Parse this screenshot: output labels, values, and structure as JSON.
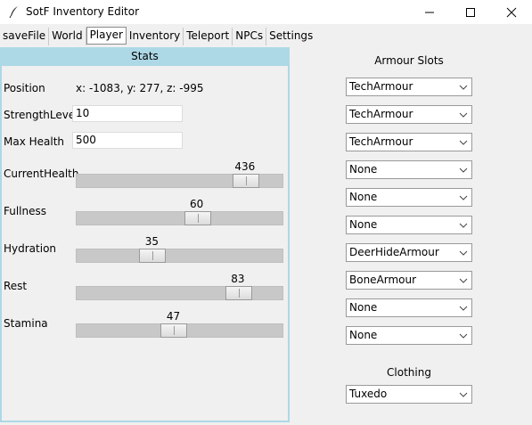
{
  "window": {
    "title": "SotF Inventory Editor"
  },
  "tabs": [
    {
      "label": "saveFile"
    },
    {
      "label": "World"
    },
    {
      "label": "Player",
      "active": true
    },
    {
      "label": "Inventory"
    },
    {
      "label": "Teleport"
    },
    {
      "label": "NPCs"
    },
    {
      "label": "Settings"
    }
  ],
  "stats": {
    "header": "Stats",
    "position": {
      "label": "Position",
      "value": "x: -1083, y: 277, z: -995"
    },
    "strength_level": {
      "label": "StrengthLevel",
      "value": "10"
    },
    "max_health": {
      "label": "Max Health",
      "value": "500"
    },
    "sliders": [
      {
        "label": "CurrentHealth",
        "value": "436",
        "fraction": 0.87
      },
      {
        "label": "Fullness",
        "value": "60",
        "fraction": 0.6
      },
      {
        "label": "Hydration",
        "value": "35",
        "fraction": 0.35
      },
      {
        "label": "Rest",
        "value": "83",
        "fraction": 0.83
      },
      {
        "label": "Stamina",
        "value": "47",
        "fraction": 0.47
      }
    ]
  },
  "armour": {
    "title": "Armour Slots",
    "slots": [
      "TechArmour",
      "TechArmour",
      "TechArmour",
      "None",
      "None",
      "None",
      "DeerHideArmour",
      "BoneArmour",
      "None",
      "None"
    ]
  },
  "clothing": {
    "title": "Clothing",
    "value": "Tuxedo"
  },
  "icons": {
    "app": "feather-icon",
    "minimize": "minimize-icon",
    "maximize": "maximize-icon",
    "close": "close-icon",
    "dropdown": "chevron-down-icon"
  }
}
